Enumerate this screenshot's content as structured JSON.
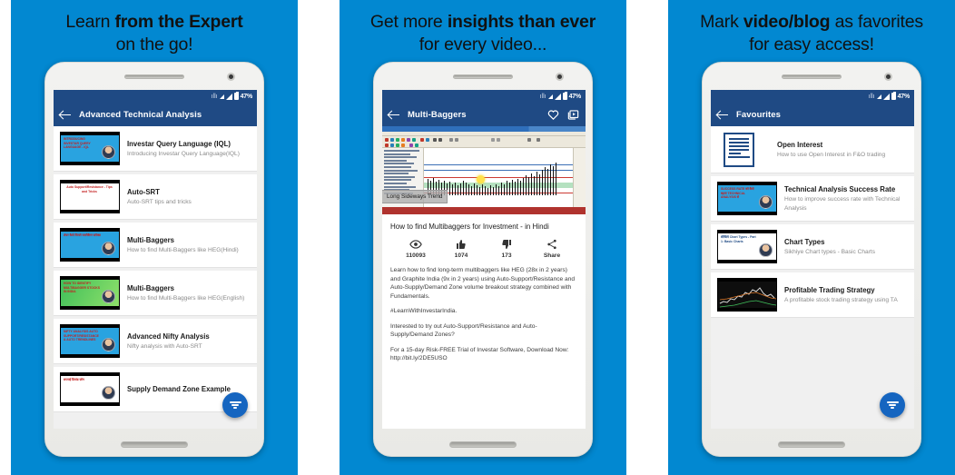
{
  "theme": {
    "background_blue": "#0288D1",
    "appbar_blue": "#1F4A84",
    "fab_blue": "#1565C0",
    "accent_red": "#B0332E"
  },
  "panels": [
    {
      "headline_line1_prefix": "Learn ",
      "headline_line1_bold": "from the Expert",
      "headline_line1_suffix": "",
      "headline_line2": "on the go!",
      "statusbar": {
        "battery": "47%"
      },
      "appbar": {
        "title": "Advanced Technical Analysis",
        "back_icon": "back-arrow-icon"
      },
      "fab": {
        "icon": "filter-funnel-icon"
      },
      "list": [
        {
          "title": "Investar Query Language (IQL)",
          "subtitle": "Introducing Investar Query Language(IQL)",
          "thumb_text": "INTRODUCING INVESTAR QUERY LANGUAGE - IQL",
          "thumb_bg": "#29a3e0",
          "thumb_color": "#c42020"
        },
        {
          "title": "Auto-SRT",
          "subtitle": "Auto-SRT tips and tricks",
          "thumb_text": "Auto Support/Resistance - Tips and Tricks",
          "thumb_bg": "#ffffff",
          "thumb_color": "#c42020"
        },
        {
          "title": "Multi-Baggers",
          "subtitle": "How to find Multi-Baggers like HEG(Hindi)",
          "thumb_text": "शेयर कैसे मिलते मल्टीबैगर स्टॉक्स",
          "thumb_bg": "#29a3e0",
          "thumb_color": "#c42020"
        },
        {
          "title": "Multi-Baggers",
          "subtitle": "How to find Multi-Baggers like HEG(English)",
          "thumb_text": "HOW TO IDENTIFY MULTIBAGGER STOCKS IN INDIA",
          "thumb_bg": "#3fbf5a",
          "thumb_color": "#c42020"
        },
        {
          "title": "Advanced Nifty Analysis",
          "subtitle": "Nifty analysis with Auto-SRT",
          "thumb_text": "NIFTY ANALYSIS AUTO SUPPORT/RESISTANCE & AUTO TRENDLINES",
          "thumb_bg": "#29a3e0",
          "thumb_color": "#c42020"
        },
        {
          "title": "Supply Demand Zone Example",
          "subtitle": "",
          "thumb_text": "सप्लाई डिमांड ज़ोन",
          "thumb_bg": "#ffffff",
          "thumb_color": "#c42020"
        }
      ],
      "navbar": {
        "back": "nav-back-icon",
        "home": "nav-home-icon",
        "recents": "nav-recents-icon"
      }
    },
    {
      "headline_line1_prefix": "Get more ",
      "headline_line1_bold": "insights than ever",
      "headline_line1_suffix": "",
      "headline_line2": "for every video...",
      "statusbar": {
        "battery": "47%"
      },
      "appbar": {
        "title": "Multi-Baggers",
        "back_icon": "back-arrow-icon",
        "favorite_icon": "heart-icon",
        "video_icon": "video-library-icon"
      },
      "video": {
        "caption": "Long Sideways Trend"
      },
      "detail": {
        "title": "How to find Multibaggers for Investment - in Hindi",
        "stats": [
          {
            "icon": "eye-icon",
            "value": "110093",
            "name": "views"
          },
          {
            "icon": "thumbs-up-icon",
            "value": "1074",
            "name": "likes"
          },
          {
            "icon": "thumbs-down-icon",
            "value": "173",
            "name": "dislikes"
          },
          {
            "icon": "share-icon",
            "value": "Share",
            "name": "share"
          }
        ],
        "paragraphs": [
          "Learn how to find long-term multibaggers like HEG (28x in 2 years) and Graphite India (9x in 2 years) using Auto-Support/Resistance and Auto-Supply/Demand Zone volume breakout strategy combined with Fundamentals.",
          "#LearnWithInvestarIndia.",
          "Interested to try out Auto-Support/Resistance and Auto-Supply/Demand Zones?",
          "For a 15-day Risk-FREE Trial of Investar Software, Download Now: http://bit.ly/2DE5USO"
        ]
      },
      "navbar": {
        "back": "nav-back-icon",
        "home": "nav-home-icon",
        "recents": "nav-recents-icon"
      }
    },
    {
      "headline_line1_prefix": "Mark ",
      "headline_line1_bold": "video/blog",
      "headline_line1_suffix": " as favorites",
      "headline_line2": "for easy access!",
      "statusbar": {
        "battery": "47%"
      },
      "appbar": {
        "title": "Favourites",
        "back_icon": "back-arrow-icon"
      },
      "fab": {
        "icon": "filter-funnel-icon"
      },
      "list": [
        {
          "title": "Open Interest",
          "subtitle": "How to use Open Interest in F&O trading",
          "kind": "blog",
          "thumb_text": "",
          "thumb_bg": "#ffffff",
          "thumb_color": "#1f4a84"
        },
        {
          "title": "Technical Analysis Success Rate",
          "subtitle": "How to improve success rate with Technical Analysis",
          "kind": "video",
          "thumb_text": "SUCCESS RATE को कैसे बढ़ाएं TECHNICAL ANALYSIS से",
          "thumb_bg": "#29a3e0",
          "thumb_color": "#c42020"
        },
        {
          "title": "Chart Types",
          "subtitle": "Sikhiye Chart types - Basic Charts",
          "kind": "video",
          "thumb_text": "सीखिये Chart Types - Part 1: Basic Charts",
          "thumb_bg": "#ffffff",
          "thumb_color": "#1f4a84"
        },
        {
          "title": "Profitable Trading Strategy",
          "subtitle": "A profitable stock trading strategy using TA",
          "kind": "video",
          "thumb_text": "",
          "thumb_bg": "#111111",
          "thumb_color": "#dddddd"
        }
      ],
      "navbar": {
        "back": "nav-back-icon",
        "home": "nav-home-icon",
        "recents": "nav-recents-icon"
      }
    }
  ]
}
